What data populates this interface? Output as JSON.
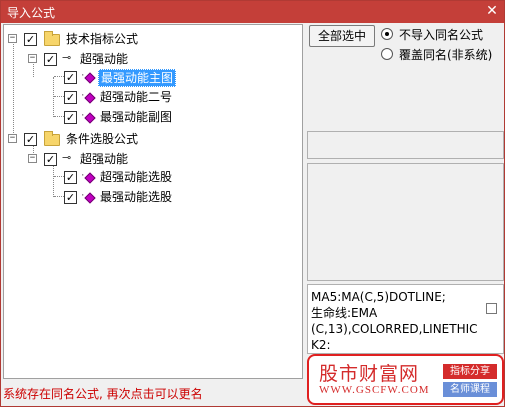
{
  "window": {
    "title": "导入公式",
    "close_glyph": "✕"
  },
  "tree": {
    "root1": {
      "label": "技术指标公式",
      "group": {
        "label": "超强动能",
        "items": [
          {
            "label": "最强动能主图",
            "selected": true
          },
          {
            "label": "超强动能二号"
          },
          {
            "label": "最强动能副图"
          }
        ]
      }
    },
    "root2": {
      "label": "条件选股公式",
      "group": {
        "label": "超强动能",
        "items": [
          {
            "label": "超强动能选股"
          },
          {
            "label": "最强动能选股"
          }
        ]
      }
    }
  },
  "options": {
    "select_all_label": "全部选中",
    "radio_skip": "不导入同名公式",
    "radio_overwrite": "覆盖同名(非系统)"
  },
  "code_text": "MA5:MA(C,5)DOTLINE;\n生命线:EMA\n(C,13),COLORRED,LINETHIC\nK2:",
  "status_text": "系统存在同名公式, 再次点击可以更名",
  "watermark": {
    "title": "股市财富网",
    "url": "WWW.GSCFW.COM",
    "tag1": "指标分享",
    "tag2": "名师课程"
  },
  "colors": {
    "titlebar": "#c43f39",
    "selection": "#3399ff",
    "status": "#cc0000"
  }
}
